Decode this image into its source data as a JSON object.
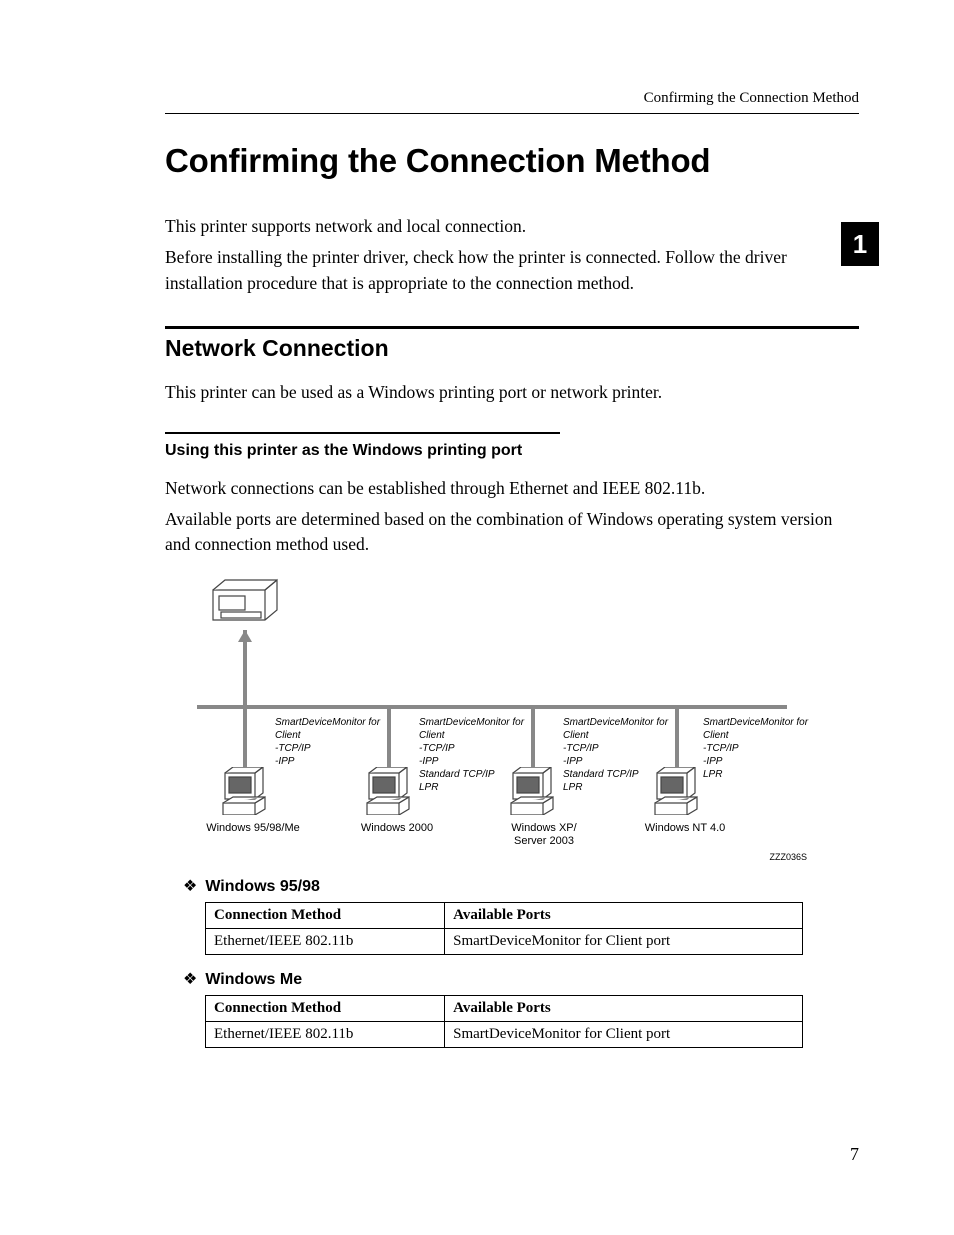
{
  "running_head": "Confirming the Connection Method",
  "chapter_tab": "1",
  "h1": "Confirming the Connection Method",
  "intro_p1": "This printer supports network and local connection.",
  "intro_p2": "Before installing the printer driver, check how the printer is connected. Follow the driver installation procedure that is appropriate to the connection method.",
  "h2": "Network Connection",
  "net_p1": "This printer can be used as a Windows printing port or network printer.",
  "h3": "Using this printer as the Windows printing port",
  "sub_p1": "Network connections can be established through Ethernet and IEEE 802.11b.",
  "sub_p2": "Available ports are determined based on the combination of Windows operating system version and connection method used.",
  "diagram": {
    "figure_id": "ZZZ036S",
    "nodes": [
      {
        "label": "Windows 95/98/Me",
        "ports": [
          "SmartDeviceMonitor for Client",
          "-TCP/IP",
          "-IPP"
        ]
      },
      {
        "label": "Windows 2000",
        "ports": [
          "SmartDeviceMonitor for Client",
          "-TCP/IP",
          "-IPP",
          "Standard TCP/IP",
          "LPR"
        ]
      },
      {
        "label": "Windows XP/ Server 2003",
        "ports": [
          "SmartDeviceMonitor for Client",
          "-TCP/IP",
          "-IPP",
          "Standard TCP/IP",
          "LPR"
        ]
      },
      {
        "label": "Windows NT 4.0",
        "ports": [
          "SmartDeviceMonitor for Client",
          "-TCP/IP",
          "-IPP",
          "LPR"
        ]
      }
    ]
  },
  "tables": [
    {
      "title": "Windows 95/98",
      "headers": [
        "Connection Method",
        "Available Ports"
      ],
      "rows": [
        [
          "Ethernet/IEEE 802.11b",
          "SmartDeviceMonitor for Client port"
        ]
      ]
    },
    {
      "title": "Windows Me",
      "headers": [
        "Connection Method",
        "Available Ports"
      ],
      "rows": [
        [
          "Ethernet/IEEE 802.11b",
          "SmartDeviceMonitor for Client port"
        ]
      ]
    }
  ],
  "page_number": "7"
}
